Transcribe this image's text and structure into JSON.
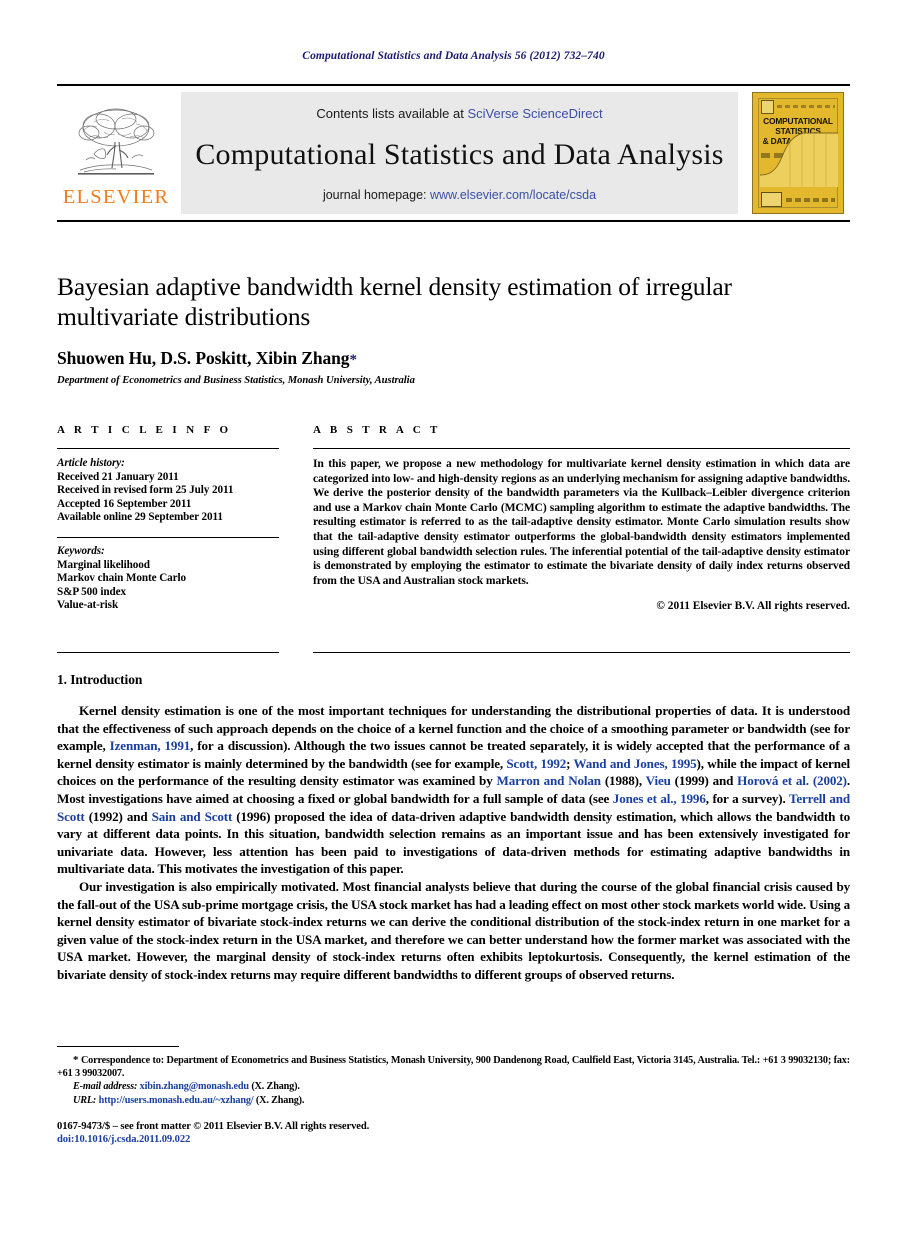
{
  "running_head": "Computational Statistics and Data Analysis 56 (2012) 732–740",
  "masthead": {
    "publisher_name": "ELSEVIER",
    "contents_prefix": "Contents lists available at ",
    "contents_link": "SciVerse ScienceDirect",
    "journal_title": "Computational Statistics and Data Analysis",
    "homepage_prefix": "journal homepage: ",
    "homepage_url": "www.elsevier.com/locate/csda",
    "cover_title_line1": "COMPUTATIONAL",
    "cover_title_line2": "STATISTICS",
    "cover_title_line3": "& DATA ANALYSIS"
  },
  "title": "Bayesian adaptive bandwidth kernel density estimation of irregular multivariate distributions",
  "authors": "Shuowen Hu, D.S. Poskitt, Xibin Zhang",
  "corresponding_marker": "*",
  "affiliation": "Department of Econometrics and Business Statistics, Monash University, Australia",
  "article_info": {
    "heading": "A R T I C L E   I N F O",
    "history_label": "Article history:",
    "history": [
      "Received 21 January 2011",
      "Received in revised form 25 July 2011",
      "Accepted 16 September 2011",
      "Available online 29 September 2011"
    ],
    "keywords_label": "Keywords:",
    "keywords": [
      "Marginal likelihood",
      "Markov chain Monte Carlo",
      "S&P 500 index",
      "Value-at-risk"
    ]
  },
  "abstract": {
    "heading": "A B S T R A C T",
    "text": "In this paper, we propose a new methodology for multivariate kernel density estimation in which data are categorized into low- and high-density regions as an underlying mechanism for assigning adaptive bandwidths. We derive the posterior density of the bandwidth parameters via the Kullback–Leibler divergence criterion and use a Markov chain Monte Carlo (MCMC) sampling algorithm to estimate the adaptive bandwidths. The resulting estimator is referred to as the tail-adaptive density estimator. Monte Carlo simulation results show that the tail-adaptive density estimator outperforms the global-bandwidth density estimators implemented using different global bandwidth selection rules. The inferential potential of the tail-adaptive density estimator is demonstrated by employing the estimator to estimate the bivariate density of daily index returns observed from the USA and Australian stock markets.",
    "copyright": "© 2011 Elsevier B.V. All rights reserved."
  },
  "section": {
    "heading": "1.  Introduction",
    "paragraph1_a": "Kernel density estimation is one of the most important techniques for understanding the distributional properties of data. It is understood that the effectiveness of such approach depends on the choice of a kernel function and the choice of a smoothing parameter or bandwidth (see for example, ",
    "cite_izenman": "Izenman, 1991",
    "paragraph1_b": ", for a discussion). Although the two issues cannot be treated separately, it is widely accepted that the performance of a kernel density estimator is mainly determined by the bandwidth (see for example, ",
    "cite_scott": "Scott, 1992",
    "paragraph1_c": "; ",
    "cite_wand": "Wand and Jones, 1995",
    "paragraph1_d": "), while the impact of kernel choices on the performance of the resulting density estimator was examined by ",
    "cite_marron": "Marron and Nolan",
    "paragraph1_e": " (1988), ",
    "cite_vieu": "Vieu",
    "paragraph1_f": " (1999) and ",
    "cite_horova": "Horová et al. (2002)",
    "paragraph1_g": ". Most investigations have aimed at choosing a fixed or global bandwidth for a full sample of data (see ",
    "cite_jones": "Jones et al., 1996",
    "paragraph1_h": ", for a survey). ",
    "cite_terrell": "Terrell and Scott",
    "paragraph1_i": " (1992) and ",
    "cite_sain": "Sain and Scott",
    "paragraph1_j": " (1996) proposed the idea of data-driven adaptive bandwidth density estimation, which allows the bandwidth to vary at different data points. In this situation, bandwidth selection remains as an important issue and has been extensively investigated for univariate data. However, less attention has been paid to investigations of data-driven methods for estimating adaptive bandwidths in multivariate data. This motivates the investigation of this paper.",
    "paragraph2": "Our investigation is also empirically motivated. Most financial analysts believe that during the course of the global financial crisis caused by the fall-out of the USA sub-prime mortgage crisis, the USA stock market has had a leading effect on most other stock markets world wide. Using a kernel density estimator of bivariate stock-index returns we can derive the conditional distribution of the stock-index return in one market for a given value of the stock-index return in the USA market, and therefore we can better understand how the former market was associated with the USA market. However, the marginal density of stock-index returns often exhibits leptokurtosis. Consequently, the kernel estimation of the bivariate density of stock-index returns may require different bandwidths to different groups of observed returns."
  },
  "footnotes": {
    "correspondence_star": "*",
    "correspondence": "Correspondence to: Department of Econometrics and Business Statistics, Monash University, 900 Dandenong Road, Caulfield East, Victoria 3145, Australia. Tel.: +61 3 99032130; fax: +61 3 99032007.",
    "email_label": "E-mail address:",
    "email_value": "xibin.zhang@monash.edu",
    "email_suffix": "(X. Zhang).",
    "url_label": "URL:",
    "url_value": "http://users.monash.edu.au/~xzhang/",
    "url_suffix": "(X. Zhang)."
  },
  "footer": {
    "issn_line": "0167-9473/$ – see front matter © 2011 Elsevier B.V. All rights reserved.",
    "doi_line": "doi:10.1016/j.csda.2011.09.022"
  },
  "colors": {
    "link_blue": "#1a3fa0",
    "runhead_blue": "#1a1a6e",
    "elsevier_orange": "#ef7d1a",
    "cover_gold": "#e3b82c",
    "masthead_grey": "#e9e9e9"
  }
}
